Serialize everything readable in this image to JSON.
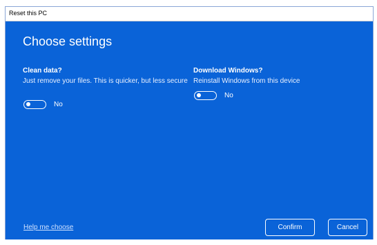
{
  "window": {
    "title": "Reset this PC"
  },
  "main": {
    "heading": "Choose settings",
    "clean_data": {
      "title": "Clean data?",
      "description": "Just remove your files. This is quicker, but less secure",
      "toggle_state": "No"
    },
    "download_windows": {
      "title": "Download Windows?",
      "description": "Reinstall Windows from this device",
      "toggle_state": "No"
    }
  },
  "footer": {
    "help_link": "Help me choose",
    "confirm_label": "Confirm",
    "cancel_label": "Cancel"
  },
  "colors": {
    "background": "#0a63d8",
    "text": "#ffffff"
  }
}
